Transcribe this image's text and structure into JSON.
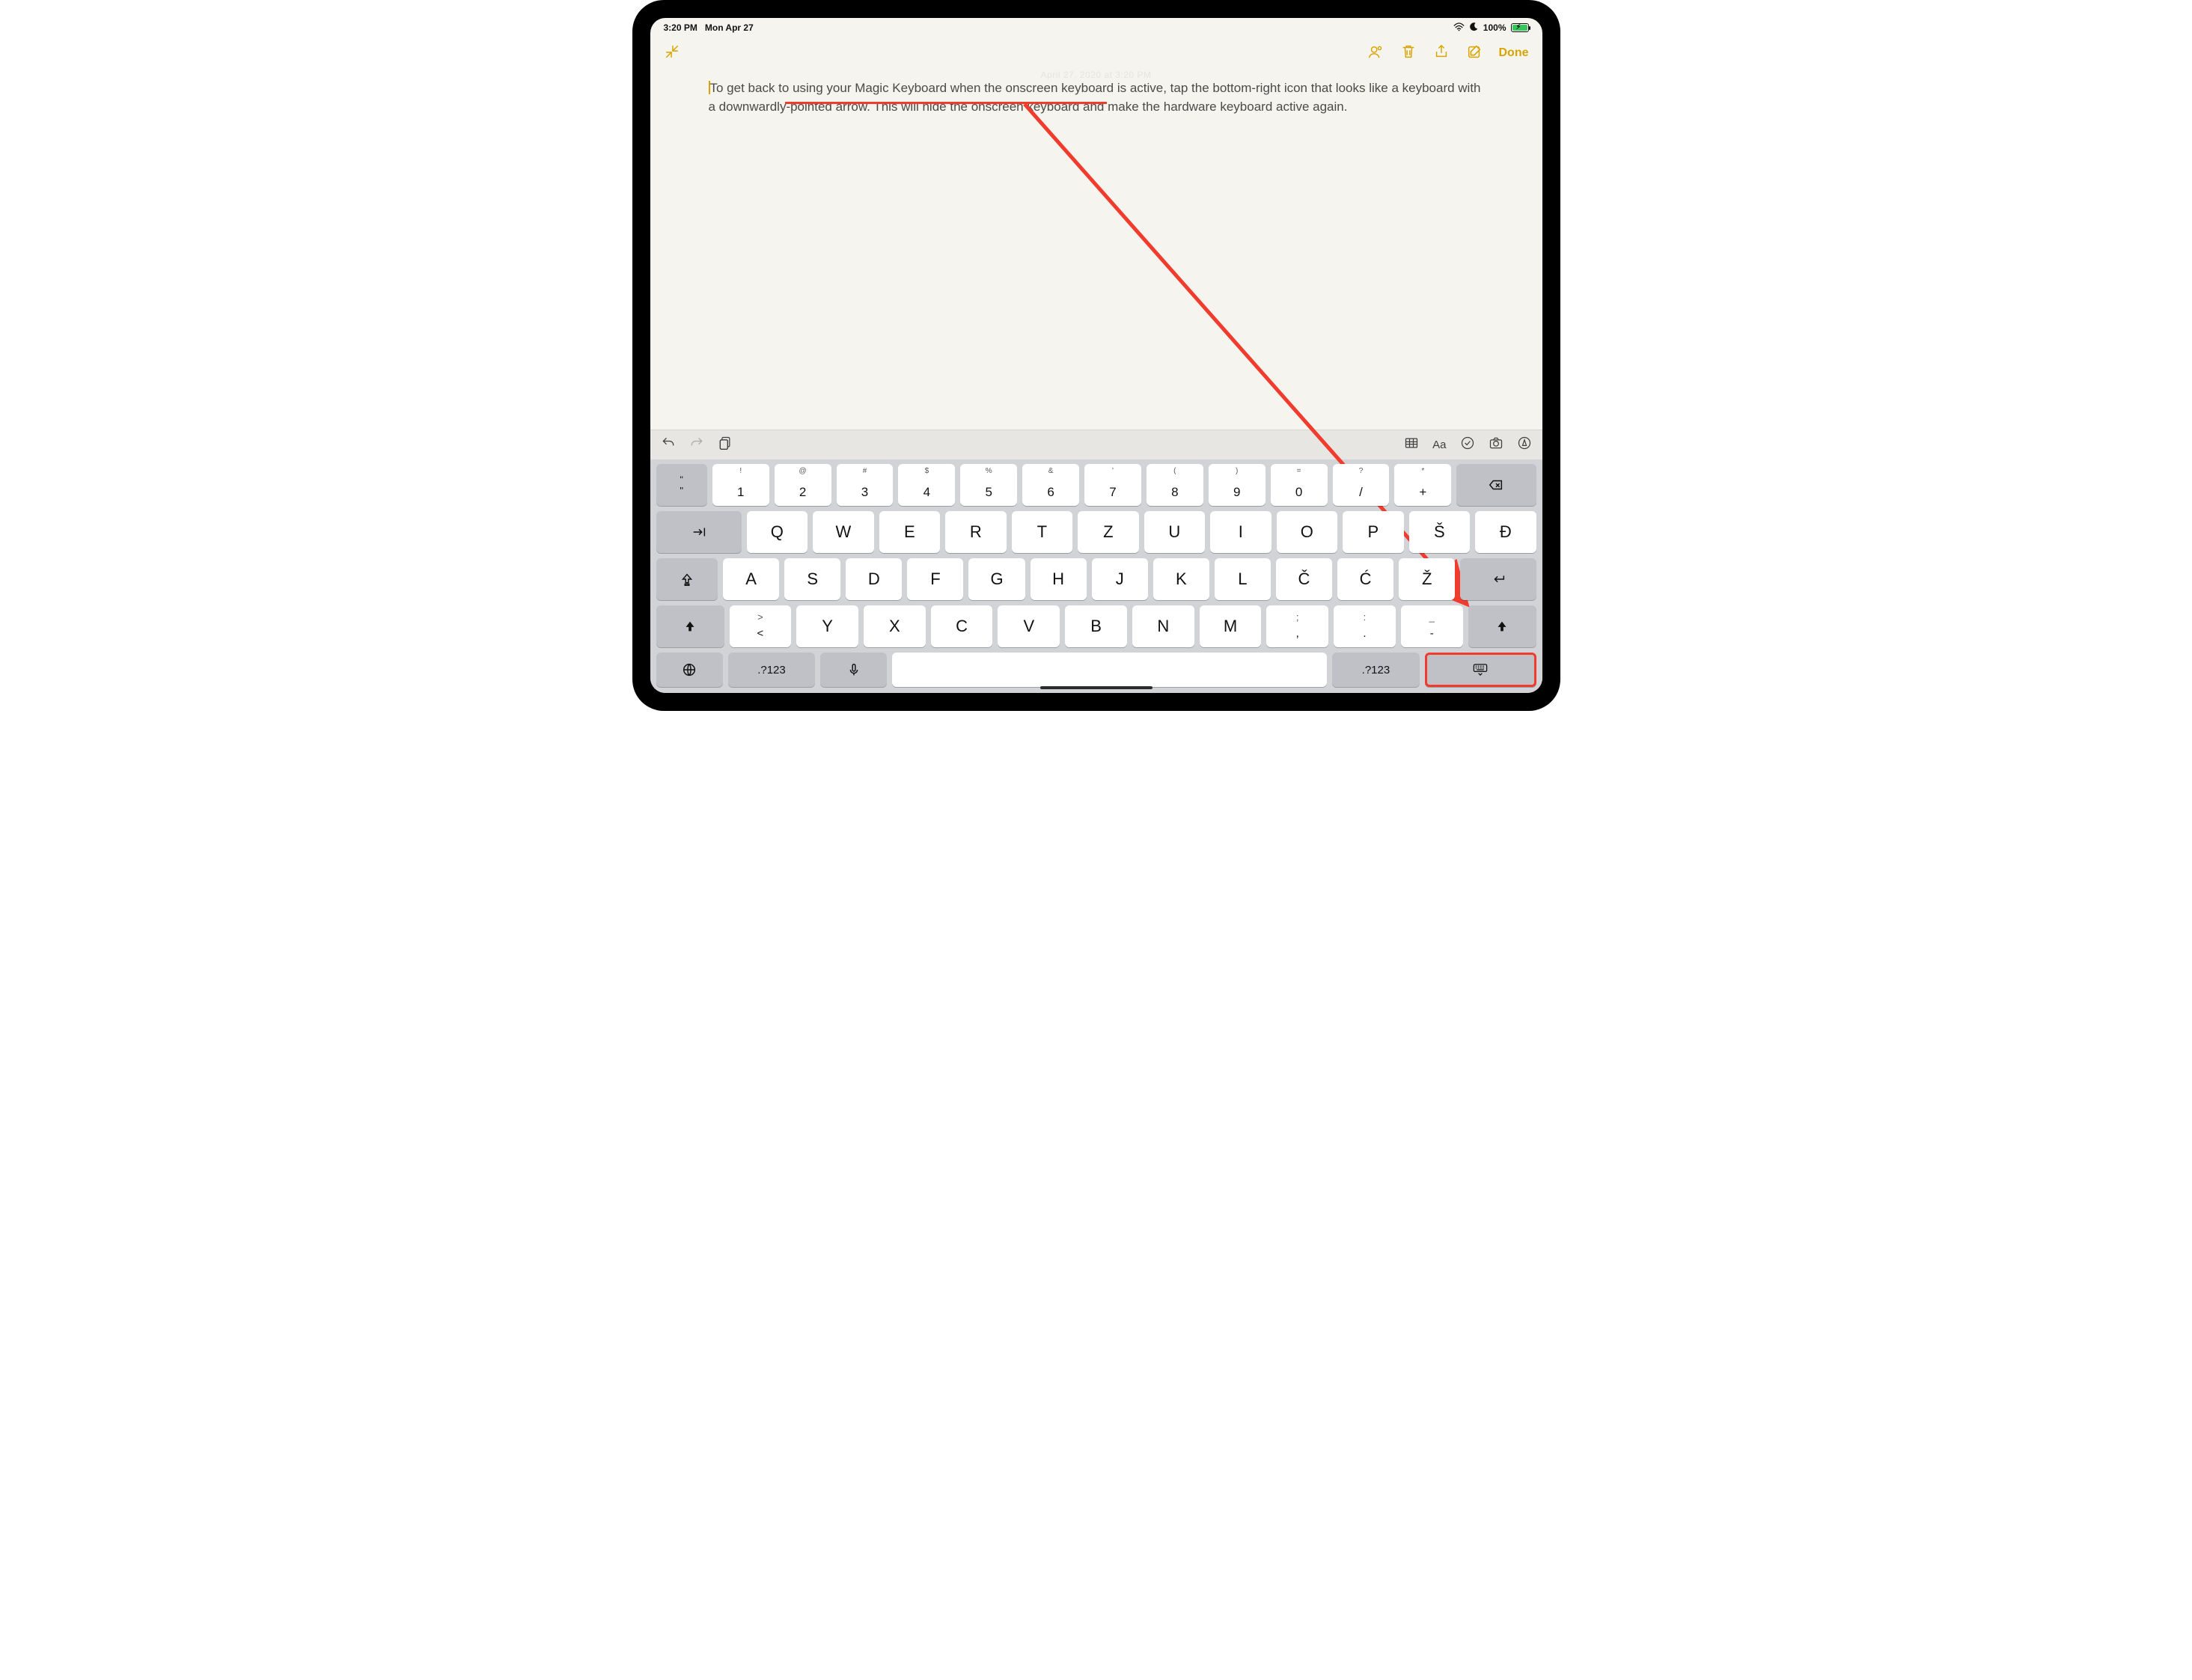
{
  "status": {
    "time": "3:20 PM",
    "date": "Mon Apr 27",
    "battery_pct": "100%"
  },
  "toolbar": {
    "done": "Done"
  },
  "note": {
    "text": "To get back to using your Magic Keyboard when the onscreen keyboard is active, tap the bottom-right icon that looks like a keyboard with a downwardly-pointed arrow. This will hide the onscreen keyboard and make the hardware keyboard active again.",
    "faint_timestamp": "April 27, 2020 at 3:20 PM"
  },
  "formatbar": {
    "aa": "Aa"
  },
  "keyboard": {
    "row1": [
      {
        "sub": "\"",
        "main": "\"",
        "dark": true,
        "name": "key-quote"
      },
      {
        "sub": "!",
        "main": "1",
        "name": "key-1"
      },
      {
        "sub": "@",
        "main": "2",
        "name": "key-2"
      },
      {
        "sub": "#",
        "main": "3",
        "name": "key-3"
      },
      {
        "sub": "$",
        "main": "4",
        "name": "key-4"
      },
      {
        "sub": "%",
        "main": "5",
        "name": "key-5"
      },
      {
        "sub": "&",
        "main": "6",
        "name": "key-6"
      },
      {
        "sub": "'",
        "main": "7",
        "name": "key-7"
      },
      {
        "sub": "(",
        "main": "8",
        "name": "key-8"
      },
      {
        "sub": ")",
        "main": "9",
        "name": "key-9"
      },
      {
        "sub": "=",
        "main": "0",
        "name": "key-0"
      },
      {
        "sub": "?",
        "main": "/",
        "name": "key-slash"
      },
      {
        "sub": "*",
        "main": "+",
        "name": "key-plus"
      }
    ],
    "row2": [
      "Q",
      "W",
      "E",
      "R",
      "T",
      "Z",
      "U",
      "I",
      "O",
      "P",
      "Š",
      "Đ"
    ],
    "row3": [
      "A",
      "S",
      "D",
      "F",
      "G",
      "H",
      "J",
      "K",
      "L",
      "Č",
      "Ć",
      "Ž"
    ],
    "row4_lead": {
      "sub": ">",
      "main": "<"
    },
    "row4": [
      "Y",
      "X",
      "C",
      "V",
      "B",
      "N",
      "M"
    ],
    "row4_punct": [
      {
        "sub": ";",
        "main": ","
      },
      {
        "sub": ":",
        "main": "."
      },
      {
        "sub": "_",
        "main": "-"
      }
    ],
    "numkey": ".?123"
  }
}
